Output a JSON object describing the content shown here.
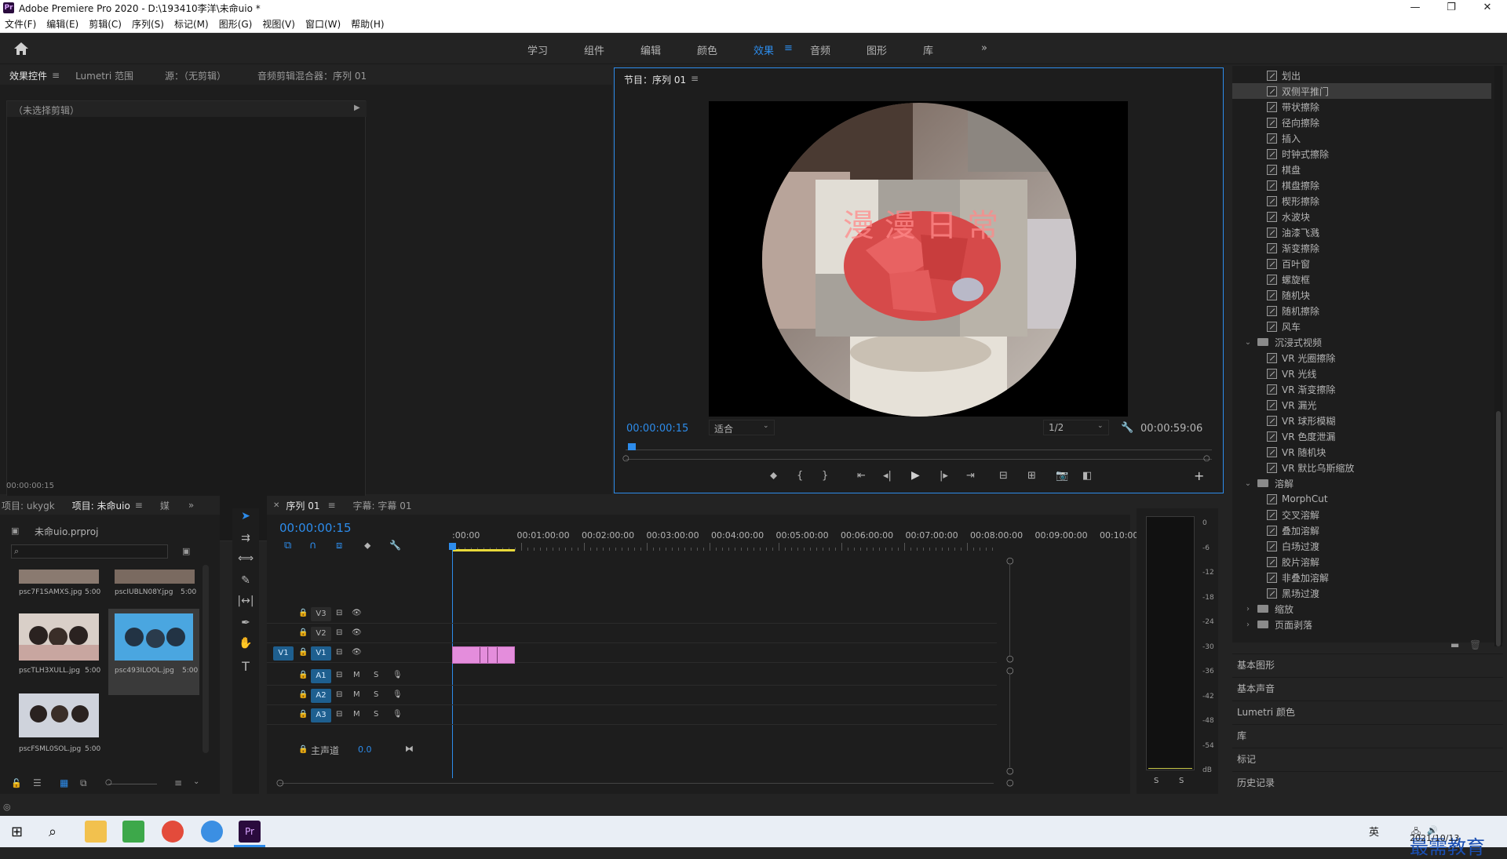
{
  "window": {
    "app_icon": "Pr",
    "title": "Adobe Premiere Pro 2020 - D:\\193410李洋\\未命uio *",
    "minimize": "—",
    "restore": "❐",
    "close": "✕"
  },
  "menu": [
    "文件(F)",
    "编辑(E)",
    "剪辑(C)",
    "序列(S)",
    "标记(M)",
    "图形(G)",
    "视图(V)",
    "窗口(W)",
    "帮助(H)"
  ],
  "workspaces": {
    "tabs": [
      "学习",
      "组件",
      "编辑",
      "颜色",
      "效果",
      "音频",
      "图形",
      "库"
    ],
    "active": "效果",
    "more": "»"
  },
  "effect_controls": {
    "tabs": [
      "效果控件",
      "Lumetri 范围",
      "源：（无剪辑）",
      "音频剪辑混合器：序列 01"
    ],
    "no_clip": "（未选择剪辑）",
    "timecode": "00:00:00:15"
  },
  "program_monitor": {
    "title": "节目：序列 01",
    "overlay_text": "漫 漫 日 常",
    "timecode": "00:00:00:15",
    "fit": "适合",
    "resolution": "1/2",
    "duration": "00:00:59:06",
    "playhead_fraction": 0.004
  },
  "effects_list": {
    "items": [
      {
        "label": "划出",
        "type": "effect"
      },
      {
        "label": "双侧平推门",
        "type": "effect",
        "selected": true
      },
      {
        "label": "带状擦除",
        "type": "effect"
      },
      {
        "label": "径向擦除",
        "type": "effect"
      },
      {
        "label": "插入",
        "type": "effect"
      },
      {
        "label": "时钟式擦除",
        "type": "effect"
      },
      {
        "label": "棋盘",
        "type": "effect"
      },
      {
        "label": "棋盘擦除",
        "type": "effect"
      },
      {
        "label": "楔形擦除",
        "type": "effect"
      },
      {
        "label": "水波块",
        "type": "effect"
      },
      {
        "label": "油漆飞溅",
        "type": "effect"
      },
      {
        "label": "渐变擦除",
        "type": "effect"
      },
      {
        "label": "百叶窗",
        "type": "effect"
      },
      {
        "label": "螺旋框",
        "type": "effect"
      },
      {
        "label": "随机块",
        "type": "effect"
      },
      {
        "label": "随机擦除",
        "type": "effect"
      },
      {
        "label": "风车",
        "type": "effect"
      },
      {
        "label": "沉浸式视频",
        "type": "folder-open"
      },
      {
        "label": "VR 光圈擦除",
        "type": "effect"
      },
      {
        "label": "VR 光线",
        "type": "effect"
      },
      {
        "label": "VR 渐变擦除",
        "type": "effect"
      },
      {
        "label": "VR 漏光",
        "type": "effect"
      },
      {
        "label": "VR 球形模糊",
        "type": "effect"
      },
      {
        "label": "VR 色度泄漏",
        "type": "effect"
      },
      {
        "label": "VR 随机块",
        "type": "effect"
      },
      {
        "label": "VR 默比乌斯缩放",
        "type": "effect"
      },
      {
        "label": "溶解",
        "type": "folder-open"
      },
      {
        "label": "MorphCut",
        "type": "effect"
      },
      {
        "label": "交叉溶解",
        "type": "effect"
      },
      {
        "label": "叠加溶解",
        "type": "effect"
      },
      {
        "label": "白场过渡",
        "type": "effect"
      },
      {
        "label": "胶片溶解",
        "type": "effect"
      },
      {
        "label": "非叠加溶解",
        "type": "effect"
      },
      {
        "label": "黑场过渡",
        "type": "effect"
      },
      {
        "label": "缩放",
        "type": "folder-closed"
      },
      {
        "label": "页面剥落",
        "type": "folder-closed"
      }
    ]
  },
  "side_panels": [
    "基本图形",
    "基本声音",
    "Lumetri 颜色",
    "库",
    "标记",
    "历史记录"
  ],
  "project": {
    "tabs": [
      "项目: ukygk",
      "项目: 未命uio",
      "媒"
    ],
    "file": "未命uio.prproj",
    "items": [
      {
        "name": "psc7F1SAMXS.jpg",
        "dur": "5:00"
      },
      {
        "name": "pscIUBLN08Y.jpg",
        "dur": "5:00"
      },
      {
        "name": "pscTLH3XULL.jpg",
        "dur": "5:00"
      },
      {
        "name": "psc493ILOOL.jpg",
        "dur": "5:00"
      },
      {
        "name": "pscFSML0SOL.jpg",
        "dur": "5:00"
      }
    ]
  },
  "timeline": {
    "tabs": [
      "序列 01",
      "字幕: 字幕 01"
    ],
    "timecode": "00:00:00:15",
    "ruler": [
      ":00:00",
      "00:01:00:00",
      "00:02:00:00",
      "00:03:00:00",
      "00:04:00:00",
      "00:05:00:00",
      "00:06:00:00",
      "00:07:00:00",
      "00:08:00:00",
      "00:09:00:00",
      "00:10:00:"
    ],
    "video_tracks": [
      "V3",
      "V2",
      "V1"
    ],
    "audio_tracks": [
      "A1",
      "A2",
      "A3"
    ],
    "master": "主声道",
    "master_value": "0.0",
    "source_patch": "V1"
  },
  "audio_meter": {
    "scale": [
      "0",
      "-6",
      "-12",
      "-18",
      "-24",
      "-30",
      "-36",
      "-42",
      "-48",
      "-54",
      "dB"
    ],
    "solo": [
      "S",
      "S"
    ]
  },
  "taskbar": {
    "date": "2021/10/13",
    "ime": "英",
    "watermark": "最需教育"
  },
  "colors": {
    "accent": "#2d8ceb",
    "clip": "#e48ddc",
    "panel_bg": "#1d1d1d"
  }
}
